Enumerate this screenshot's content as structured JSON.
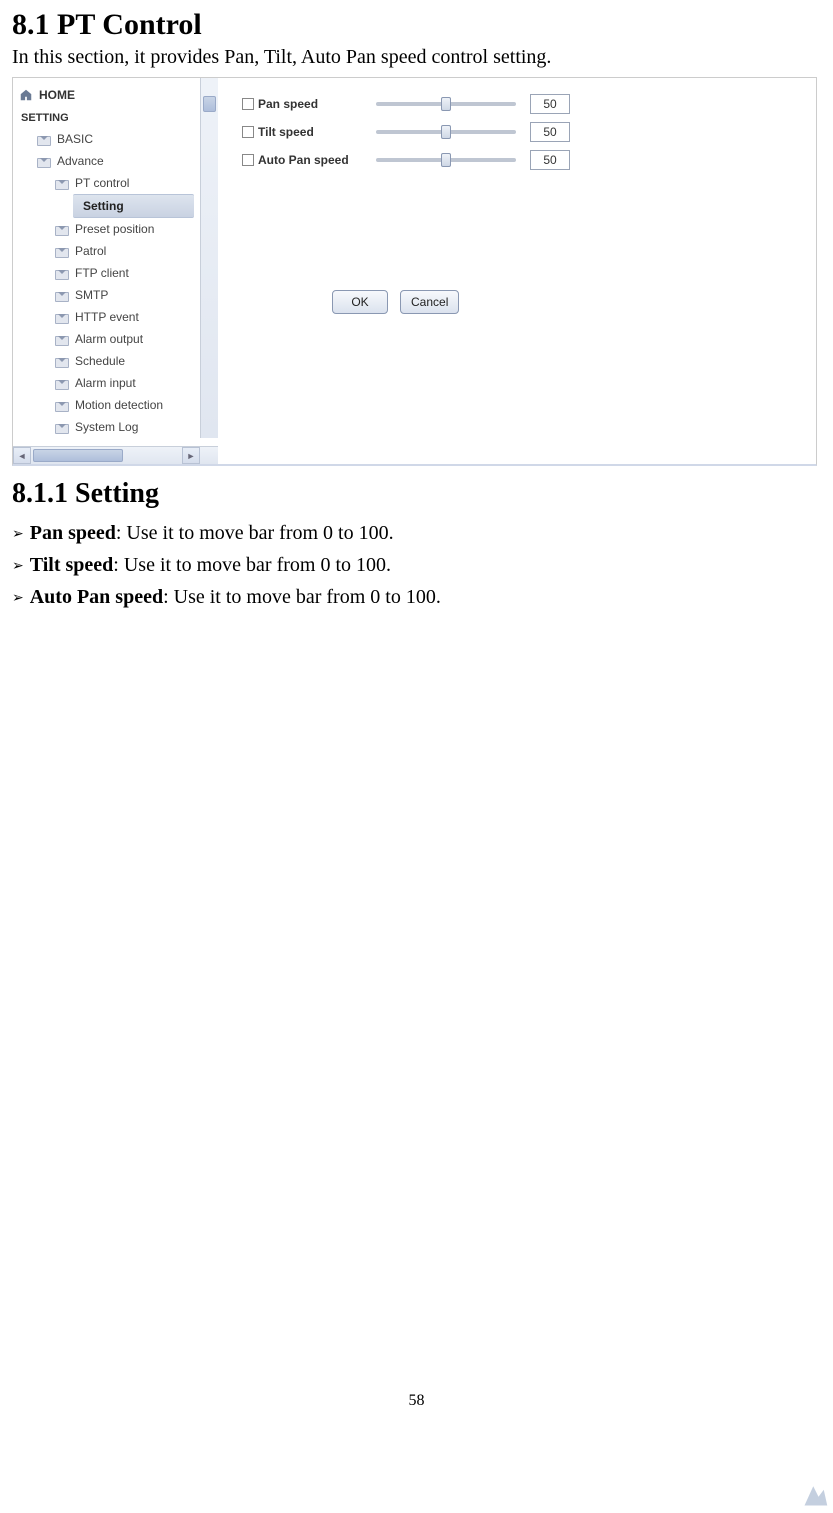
{
  "heading_main": "8.1 PT Control",
  "intro_text": "In this section, it provides Pan, Tilt, Auto Pan speed control setting.",
  "sidebar": {
    "home": "HOME",
    "setting_heading": "SETTING",
    "basic": "BASIC",
    "advance": "Advance",
    "pt_control": "PT control",
    "setting_item": "Setting",
    "preset_position": "Preset position",
    "patrol": "Patrol",
    "ftp_client": "FTP client",
    "smtp": "SMTP",
    "http_event": "HTTP event",
    "alarm_output": "Alarm output",
    "schedule": "Schedule",
    "alarm_input": "Alarm input",
    "motion_detection": "Motion detection",
    "system_log": "System Log"
  },
  "sliders": {
    "pan": {
      "label": "Pan speed",
      "value": "50",
      "thumb_pct": 50
    },
    "tilt": {
      "label": "Tilt speed",
      "value": "50",
      "thumb_pct": 50
    },
    "autopan": {
      "label": "Auto Pan speed",
      "value": "50",
      "thumb_pct": 50
    }
  },
  "buttons": {
    "ok": "OK",
    "cancel": "Cancel"
  },
  "heading_sub": "8.1.1 Setting",
  "bullets": {
    "b1_bold": "Pan speed",
    "b1_rest": ": Use it to move bar from 0 to 100.",
    "b2_bold": "Tilt speed",
    "b2_rest": ": Use it to move bar from 0 to 100.",
    "b3_bold": "Auto Pan speed",
    "b3_rest": ": Use it to move bar from 0 to 100."
  },
  "page_number": "58"
}
